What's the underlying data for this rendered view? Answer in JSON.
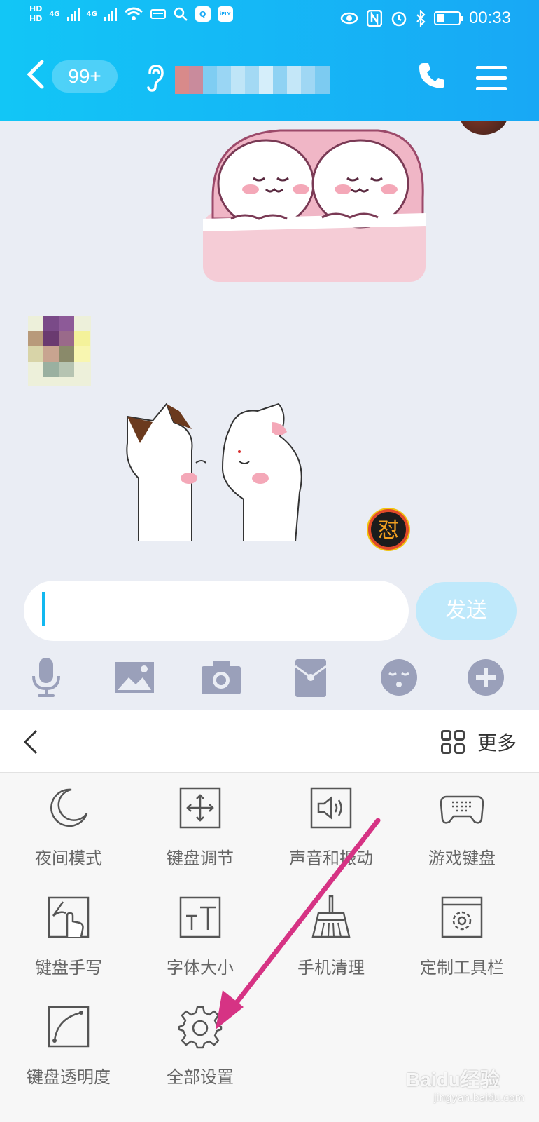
{
  "status_bar": {
    "hd1": "HD",
    "hd2": "HD",
    "net1": "4G",
    "net2": "4G",
    "app_icon_label": "iFLY",
    "time": "00:33"
  },
  "header": {
    "unread_badge": "99+"
  },
  "chat": {
    "reaction_glyph": "怼"
  },
  "input": {
    "value": "",
    "send_label": "发送"
  },
  "keyboard": {
    "more_label": "更多",
    "items": [
      {
        "label": "夜间模式",
        "icon": "moon-icon"
      },
      {
        "label": "键盘调节",
        "icon": "keyboard-adjust-icon"
      },
      {
        "label": "声音和振动",
        "icon": "sound-vibration-icon"
      },
      {
        "label": "游戏键盘",
        "icon": "gamepad-icon"
      },
      {
        "label": "键盘手写",
        "icon": "handwriting-icon"
      },
      {
        "label": "字体大小",
        "icon": "font-size-icon"
      },
      {
        "label": "手机清理",
        "icon": "broom-icon"
      },
      {
        "label": "定制工具栏",
        "icon": "custom-toolbar-icon"
      },
      {
        "label": "键盘透明度",
        "icon": "transparency-icon"
      },
      {
        "label": "全部设置",
        "icon": "settings-gear-icon"
      }
    ]
  },
  "watermark": {
    "text": "Baidu经验",
    "url": "jingyan.baidu.com"
  },
  "colors": {
    "header": "#18a8f5",
    "send_button": "#bfe9fb",
    "arrow": "#d63384"
  }
}
